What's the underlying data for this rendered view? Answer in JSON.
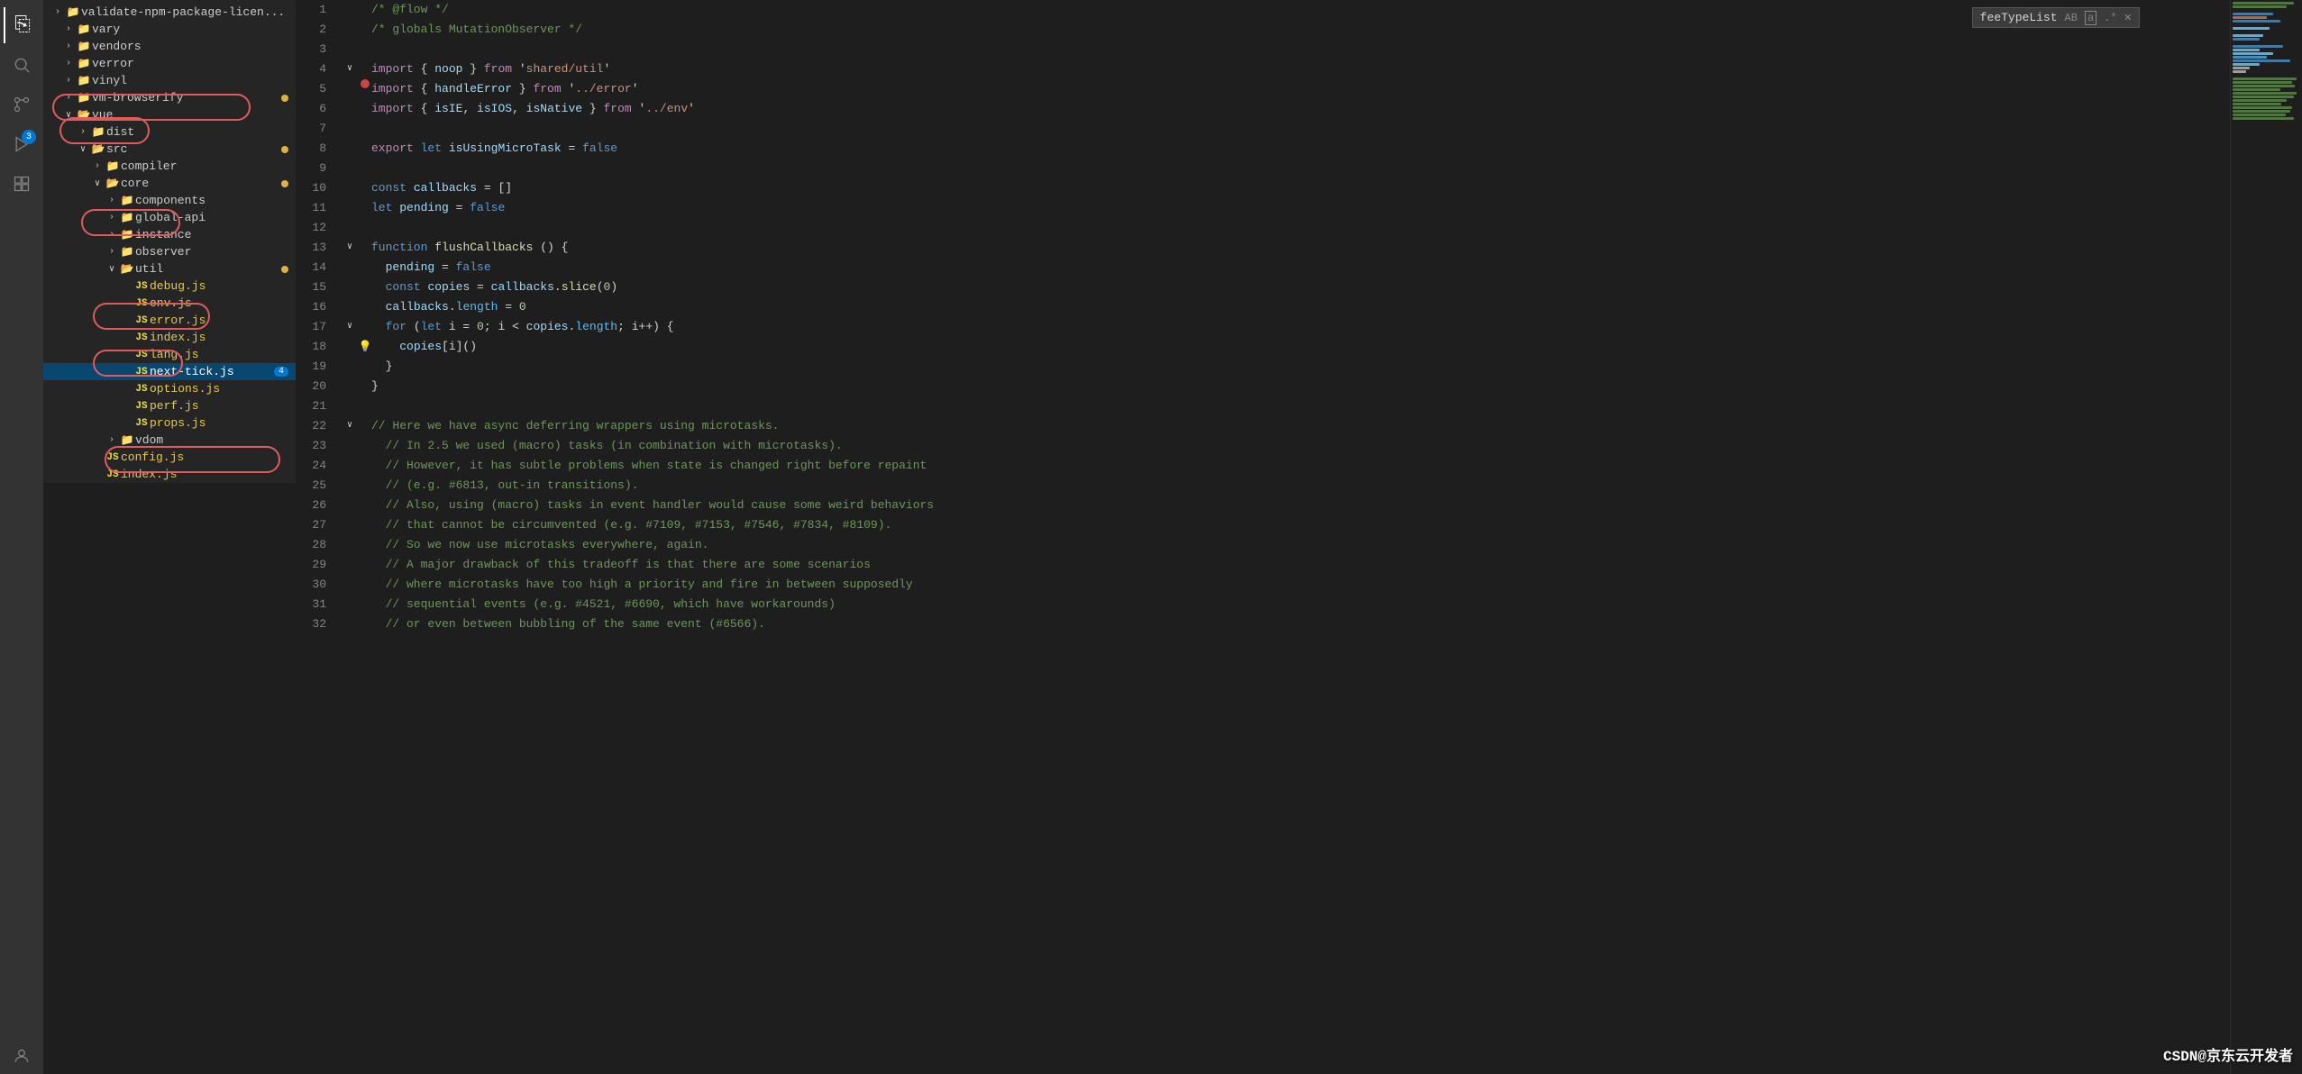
{
  "activityBar": {
    "icons": [
      {
        "name": "explorer-icon",
        "symbol": "⎘",
        "active": true
      },
      {
        "name": "search-icon",
        "symbol": "🔍",
        "active": false
      },
      {
        "name": "git-icon",
        "symbol": "⑂",
        "active": false
      },
      {
        "name": "debug-icon",
        "symbol": "▷",
        "active": false,
        "badge": "3"
      },
      {
        "name": "extensions-icon",
        "symbol": "⊞",
        "active": false
      },
      {
        "name": "user-icon",
        "symbol": "👤",
        "active": false
      }
    ]
  },
  "sidebar": {
    "items": [
      {
        "id": "validate-npm",
        "label": "validate-npm-package-licen...",
        "type": "folder",
        "indent": 0,
        "arrow": "›",
        "dot": false
      },
      {
        "id": "vary",
        "label": "vary",
        "type": "folder",
        "indent": 1,
        "arrow": "›",
        "dot": false
      },
      {
        "id": "vendors",
        "label": "vendors",
        "type": "folder",
        "indent": 1,
        "arrow": "›",
        "dot": false
      },
      {
        "id": "verror",
        "label": "verror",
        "type": "folder",
        "indent": 1,
        "arrow": "›",
        "dot": false
      },
      {
        "id": "vinyl",
        "label": "vinyl",
        "type": "folder",
        "indent": 1,
        "arrow": "›",
        "dot": false
      },
      {
        "id": "vm-browserify",
        "label": "vm-browserify",
        "type": "folder",
        "indent": 1,
        "arrow": "›",
        "dot": true
      },
      {
        "id": "vue",
        "label": "vue",
        "type": "folder-open",
        "indent": 1,
        "arrow": "∨",
        "dot": false
      },
      {
        "id": "dist",
        "label": "dist",
        "type": "folder",
        "indent": 2,
        "arrow": "›",
        "dot": false
      },
      {
        "id": "src",
        "label": "src",
        "type": "folder-open",
        "indent": 2,
        "arrow": "∨",
        "dot": true
      },
      {
        "id": "compiler",
        "label": "compiler",
        "type": "folder",
        "indent": 3,
        "arrow": "›",
        "dot": false
      },
      {
        "id": "core",
        "label": "core",
        "type": "folder-open",
        "indent": 3,
        "arrow": "∨",
        "dot": true
      },
      {
        "id": "components",
        "label": "components",
        "type": "folder",
        "indent": 4,
        "arrow": "›",
        "dot": false
      },
      {
        "id": "global-api",
        "label": "global-api",
        "type": "folder",
        "indent": 4,
        "arrow": "›",
        "dot": false
      },
      {
        "id": "instance",
        "label": "instance",
        "type": "folder",
        "indent": 4,
        "arrow": "›",
        "dot": false
      },
      {
        "id": "observer",
        "label": "observer",
        "type": "folder",
        "indent": 4,
        "arrow": "›",
        "dot": false
      },
      {
        "id": "util",
        "label": "util",
        "type": "folder-open",
        "indent": 4,
        "arrow": "∨",
        "dot": true
      },
      {
        "id": "debug-js",
        "label": "debug.js",
        "type": "js",
        "indent": 5,
        "dot": false
      },
      {
        "id": "env-js",
        "label": "env.js",
        "type": "js",
        "indent": 5,
        "dot": false
      },
      {
        "id": "error-js",
        "label": "error.js",
        "type": "js",
        "indent": 5,
        "dot": false
      },
      {
        "id": "index-js",
        "label": "index.js",
        "type": "js",
        "indent": 5,
        "dot": false
      },
      {
        "id": "lang-js",
        "label": "lang.js",
        "type": "js",
        "indent": 5,
        "dot": false
      },
      {
        "id": "next-tick-js",
        "label": "next-tick.js",
        "type": "js",
        "indent": 5,
        "dot": false,
        "selected": true,
        "badge": "4"
      },
      {
        "id": "options-js",
        "label": "options.js",
        "type": "js",
        "indent": 5,
        "dot": false
      },
      {
        "id": "perf-js",
        "label": "perf.js",
        "type": "js",
        "indent": 5,
        "dot": false
      },
      {
        "id": "props-js",
        "label": "props.js",
        "type": "js",
        "indent": 5,
        "dot": false
      },
      {
        "id": "vdom",
        "label": "vdom",
        "type": "folder",
        "indent": 4,
        "arrow": "›",
        "dot": false
      },
      {
        "id": "config-js",
        "label": "config.js",
        "type": "js",
        "indent": 3,
        "dot": false
      },
      {
        "id": "index-js2",
        "label": "index.js",
        "type": "js",
        "indent": 3,
        "dot": false
      }
    ]
  },
  "searchBar": {
    "value": "feeTypeList",
    "placeholder": "feeTypeList"
  },
  "editor": {
    "lines": [
      {
        "num": 1,
        "foldable": false,
        "indicator": null,
        "code": "/* @flow */",
        "tokens": [
          {
            "text": "/* @flow */",
            "cls": "cmt"
          }
        ]
      },
      {
        "num": 2,
        "foldable": false,
        "indicator": null,
        "code": "/* globals MutationObserver */",
        "tokens": [
          {
            "text": "/* globals MutationObserver */",
            "cls": "cmt"
          }
        ]
      },
      {
        "num": 3,
        "foldable": false,
        "indicator": null,
        "code": "",
        "tokens": []
      },
      {
        "num": 4,
        "foldable": true,
        "open": true,
        "indicator": null,
        "code": "import { noop } from 'shared/util'",
        "tokens": [
          {
            "text": "import",
            "cls": "kw2"
          },
          {
            "text": " { ",
            "cls": "punc"
          },
          {
            "text": "noop",
            "cls": "var"
          },
          {
            "text": " } ",
            "cls": "punc"
          },
          {
            "text": "from",
            "cls": "kw2"
          },
          {
            "text": " '",
            "cls": "punc"
          },
          {
            "text": "shared/util",
            "cls": "str"
          },
          {
            "text": "'",
            "cls": "punc"
          }
        ]
      },
      {
        "num": 5,
        "foldable": false,
        "indicator": "breakpoint",
        "code": "  import { handleError } from '../error'",
        "tokens": [
          {
            "text": "import",
            "cls": "kw2"
          },
          {
            "text": " { ",
            "cls": "punc"
          },
          {
            "text": "handleError",
            "cls": "var"
          },
          {
            "text": " } ",
            "cls": "punc"
          },
          {
            "text": "from",
            "cls": "kw2"
          },
          {
            "text": " '",
            "cls": "punc"
          },
          {
            "text": "../error",
            "cls": "str"
          },
          {
            "text": "'",
            "cls": "punc"
          }
        ]
      },
      {
        "num": 6,
        "foldable": false,
        "indicator": null,
        "code": "  import { isIE, isIOS, isNative } from '../env'",
        "tokens": [
          {
            "text": "import",
            "cls": "kw2"
          },
          {
            "text": " { ",
            "cls": "punc"
          },
          {
            "text": "isIE",
            "cls": "var"
          },
          {
            "text": ", ",
            "cls": "punc"
          },
          {
            "text": "isIOS",
            "cls": "var"
          },
          {
            "text": ", ",
            "cls": "punc"
          },
          {
            "text": "isNative",
            "cls": "var"
          },
          {
            "text": " } ",
            "cls": "punc"
          },
          {
            "text": "from",
            "cls": "kw2"
          },
          {
            "text": " '",
            "cls": "punc"
          },
          {
            "text": "../env",
            "cls": "str"
          },
          {
            "text": "'",
            "cls": "punc"
          }
        ]
      },
      {
        "num": 7,
        "foldable": false,
        "indicator": null,
        "code": "",
        "tokens": []
      },
      {
        "num": 8,
        "foldable": false,
        "indicator": null,
        "code": "export let isUsingMicroTask = false",
        "tokens": [
          {
            "text": "export",
            "cls": "kw2"
          },
          {
            "text": " ",
            "cls": "plain"
          },
          {
            "text": "let",
            "cls": "kw"
          },
          {
            "text": " ",
            "cls": "plain"
          },
          {
            "text": "isUsingMicroTask",
            "cls": "var"
          },
          {
            "text": " = ",
            "cls": "op"
          },
          {
            "text": "false",
            "cls": "kw"
          }
        ]
      },
      {
        "num": 9,
        "foldable": false,
        "indicator": null,
        "code": "",
        "tokens": []
      },
      {
        "num": 10,
        "foldable": false,
        "indicator": null,
        "code": "const callbacks = []",
        "tokens": [
          {
            "text": "const",
            "cls": "kw"
          },
          {
            "text": " ",
            "cls": "plain"
          },
          {
            "text": "callbacks",
            "cls": "var"
          },
          {
            "text": " = []",
            "cls": "punc"
          }
        ]
      },
      {
        "num": 11,
        "foldable": false,
        "indicator": null,
        "code": "let pending = false",
        "tokens": [
          {
            "text": "let",
            "cls": "kw"
          },
          {
            "text": " ",
            "cls": "plain"
          },
          {
            "text": "pending",
            "cls": "var"
          },
          {
            "text": " = ",
            "cls": "op"
          },
          {
            "text": "false",
            "cls": "kw"
          }
        ]
      },
      {
        "num": 12,
        "foldable": false,
        "indicator": null,
        "code": "",
        "tokens": []
      },
      {
        "num": 13,
        "foldable": true,
        "open": true,
        "indicator": null,
        "code": "function flushCallbacks () {",
        "tokens": [
          {
            "text": "function",
            "cls": "kw"
          },
          {
            "text": " ",
            "cls": "plain"
          },
          {
            "text": "flushCallbacks",
            "cls": "fn"
          },
          {
            "text": " () {",
            "cls": "punc"
          }
        ]
      },
      {
        "num": 14,
        "foldable": false,
        "indicator": null,
        "code": "  pending = false",
        "tokens": [
          {
            "text": "  ",
            "cls": "plain"
          },
          {
            "text": "pending",
            "cls": "var"
          },
          {
            "text": " = ",
            "cls": "op"
          },
          {
            "text": "false",
            "cls": "kw"
          }
        ]
      },
      {
        "num": 15,
        "foldable": false,
        "indicator": null,
        "code": "  const copies = callbacks.slice(0)",
        "tokens": [
          {
            "text": "  ",
            "cls": "plain"
          },
          {
            "text": "const",
            "cls": "kw"
          },
          {
            "text": " ",
            "cls": "plain"
          },
          {
            "text": "copies",
            "cls": "var"
          },
          {
            "text": " = ",
            "cls": "op"
          },
          {
            "text": "callbacks",
            "cls": "var"
          },
          {
            "text": ".",
            "cls": "punc"
          },
          {
            "text": "slice",
            "cls": "fn"
          },
          {
            "text": "(",
            "cls": "punc"
          },
          {
            "text": "0",
            "cls": "num"
          },
          {
            "text": ")",
            "cls": "punc"
          }
        ]
      },
      {
        "num": 16,
        "foldable": false,
        "indicator": null,
        "code": "  callbacks.length = 0",
        "tokens": [
          {
            "text": "  ",
            "cls": "plain"
          },
          {
            "text": "callbacks",
            "cls": "var"
          },
          {
            "text": ".",
            "cls": "punc"
          },
          {
            "text": "length",
            "cls": "prop"
          },
          {
            "text": " = ",
            "cls": "op"
          },
          {
            "text": "0",
            "cls": "num"
          }
        ]
      },
      {
        "num": 17,
        "foldable": true,
        "open": true,
        "indicator": null,
        "code": "  for (let i = 0; i < copies.length; i++) {",
        "tokens": [
          {
            "text": "  ",
            "cls": "plain"
          },
          {
            "text": "for",
            "cls": "kw"
          },
          {
            "text": " (",
            "cls": "punc"
          },
          {
            "text": "let",
            "cls": "kw"
          },
          {
            "text": " i = ",
            "cls": "plain"
          },
          {
            "text": "0",
            "cls": "num"
          },
          {
            "text": "; i < ",
            "cls": "plain"
          },
          {
            "text": "copies",
            "cls": "var"
          },
          {
            "text": ".",
            "cls": "punc"
          },
          {
            "text": "length",
            "cls": "prop"
          },
          {
            "text": "; i++) {",
            "cls": "punc"
          }
        ]
      },
      {
        "num": 18,
        "foldable": false,
        "indicator": "lightbulb",
        "code": "    copies[i]()",
        "tokens": [
          {
            "text": "    ",
            "cls": "plain"
          },
          {
            "text": "copies",
            "cls": "var"
          },
          {
            "text": "[i]()",
            "cls": "punc"
          }
        ]
      },
      {
        "num": 19,
        "foldable": false,
        "indicator": null,
        "code": "  }",
        "tokens": [
          {
            "text": "  }",
            "cls": "punc"
          }
        ]
      },
      {
        "num": 20,
        "foldable": false,
        "indicator": null,
        "code": "}",
        "tokens": [
          {
            "text": "}",
            "cls": "punc"
          }
        ]
      },
      {
        "num": 21,
        "foldable": false,
        "indicator": null,
        "code": "",
        "tokens": []
      },
      {
        "num": 22,
        "foldable": true,
        "open": true,
        "indicator": null,
        "code": "// Here we have async deferring wrappers using microtasks.",
        "tokens": [
          {
            "text": "// Here we have async deferring wrappers using microtasks.",
            "cls": "cmt"
          }
        ]
      },
      {
        "num": 23,
        "foldable": false,
        "indicator": null,
        "code": "  // In 2.5 we used (macro) tasks (in combination with microtasks).",
        "tokens": [
          {
            "text": "  // In 2.5 we used (macro) tasks (in combination with microtasks).",
            "cls": "cmt"
          }
        ]
      },
      {
        "num": 24,
        "foldable": false,
        "indicator": null,
        "code": "  // However, it has subtle problems when state is changed right before repaint",
        "tokens": [
          {
            "text": "  // However, it has subtle problems when state is changed right before repaint",
            "cls": "cmt"
          }
        ]
      },
      {
        "num": 25,
        "foldable": false,
        "indicator": null,
        "code": "  // (e.g. #6813, out-in transitions).",
        "tokens": [
          {
            "text": "  // (e.g. #6813, out-in transitions).",
            "cls": "cmt"
          }
        ]
      },
      {
        "num": 26,
        "foldable": false,
        "indicator": null,
        "code": "  // Also, using (macro) tasks in event handler would cause some weird behaviors",
        "tokens": [
          {
            "text": "  // Also, using (macro) tasks in event handler would cause some weird behaviors",
            "cls": "cmt"
          }
        ]
      },
      {
        "num": 27,
        "foldable": false,
        "indicator": null,
        "code": "  // that cannot be circumvented (e.g. #7109, #7153, #7546, #7834, #8109).",
        "tokens": [
          {
            "text": "  // that cannot be circumvented (e.g. #7109, #7153, #7546, #7834, #8109).",
            "cls": "cmt"
          }
        ]
      },
      {
        "num": 28,
        "foldable": false,
        "indicator": null,
        "code": "  // So we now use microtasks everywhere, again.",
        "tokens": [
          {
            "text": "  // So we now use microtasks everywhere, again.",
            "cls": "cmt"
          }
        ]
      },
      {
        "num": 29,
        "foldable": false,
        "indicator": null,
        "code": "  // A major drawback of this tradeoff is that there are some scenarios",
        "tokens": [
          {
            "text": "  // A major drawback of this tradeoff is that there are some scenarios",
            "cls": "cmt"
          }
        ]
      },
      {
        "num": 30,
        "foldable": false,
        "indicator": null,
        "code": "  // where microtasks have too high a priority and fire in between supposedly",
        "tokens": [
          {
            "text": "  // where microtasks have too high a priority and fire in between supposedly",
            "cls": "cmt"
          }
        ]
      },
      {
        "num": 31,
        "foldable": false,
        "indicator": null,
        "code": "  // sequential events (e.g. #4521, #6690, which have workarounds)",
        "tokens": [
          {
            "text": "  // sequential events (e.g. #4521, #6690, which have workarounds)",
            "cls": "cmt"
          }
        ]
      },
      {
        "num": 32,
        "foldable": false,
        "indicator": null,
        "code": "  // or even between bubbling of the same event (#6566).",
        "tokens": [
          {
            "text": "  // or even between bubbling of the same event (#6566).",
            "cls": "cmt"
          }
        ]
      }
    ]
  },
  "watermark": {
    "text": "CSDN@京东云开发者"
  }
}
